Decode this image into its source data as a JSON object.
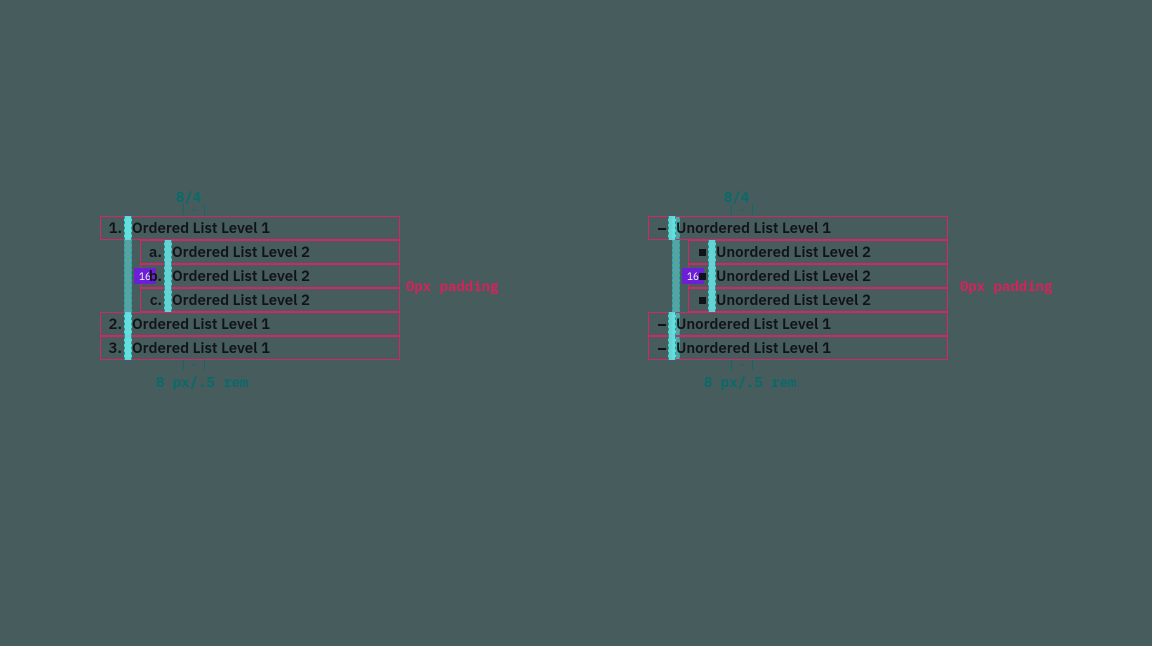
{
  "colors": {
    "background": "#475c5c",
    "outline": "#d12765",
    "highlight": "#6ee7e7",
    "badge": "#6b1fd6",
    "annotation_teal": "#056b6b",
    "padding_red": "#e01e5a",
    "text": "#101418"
  },
  "annotations": {
    "top_label": "8/4",
    "bottom_label": "8 px/.5 rem",
    "badge_value": "16",
    "padding_note": "0px padding"
  },
  "ordered": {
    "rows": [
      {
        "level": 1,
        "marker": "1.",
        "text": "Ordered List Level 1"
      },
      {
        "level": 2,
        "marker": "a.",
        "text": "Ordered List Level 2"
      },
      {
        "level": 2,
        "marker": "b.",
        "text": "Ordered List Level 2",
        "badge": true
      },
      {
        "level": 2,
        "marker": "c.",
        "text": "Ordered List Level 2"
      },
      {
        "level": 1,
        "marker": "2.",
        "text": "Ordered List Level 1"
      },
      {
        "level": 1,
        "marker": "3.",
        "text": "Ordered List Level 1"
      }
    ]
  },
  "unordered": {
    "rows": [
      {
        "level": 1,
        "marker": "dash",
        "text": "Unordered List Level 1"
      },
      {
        "level": 2,
        "marker": "square",
        "text": "Unordered List Level 2"
      },
      {
        "level": 2,
        "marker": "square",
        "text": "Unordered List Level 2",
        "badge": true
      },
      {
        "level": 2,
        "marker": "square",
        "text": "Unordered List Level 2"
      },
      {
        "level": 1,
        "marker": "dash",
        "text": "Unordered List Level 1"
      },
      {
        "level": 1,
        "marker": "dash",
        "text": "Unordered List Level 1"
      }
    ]
  }
}
